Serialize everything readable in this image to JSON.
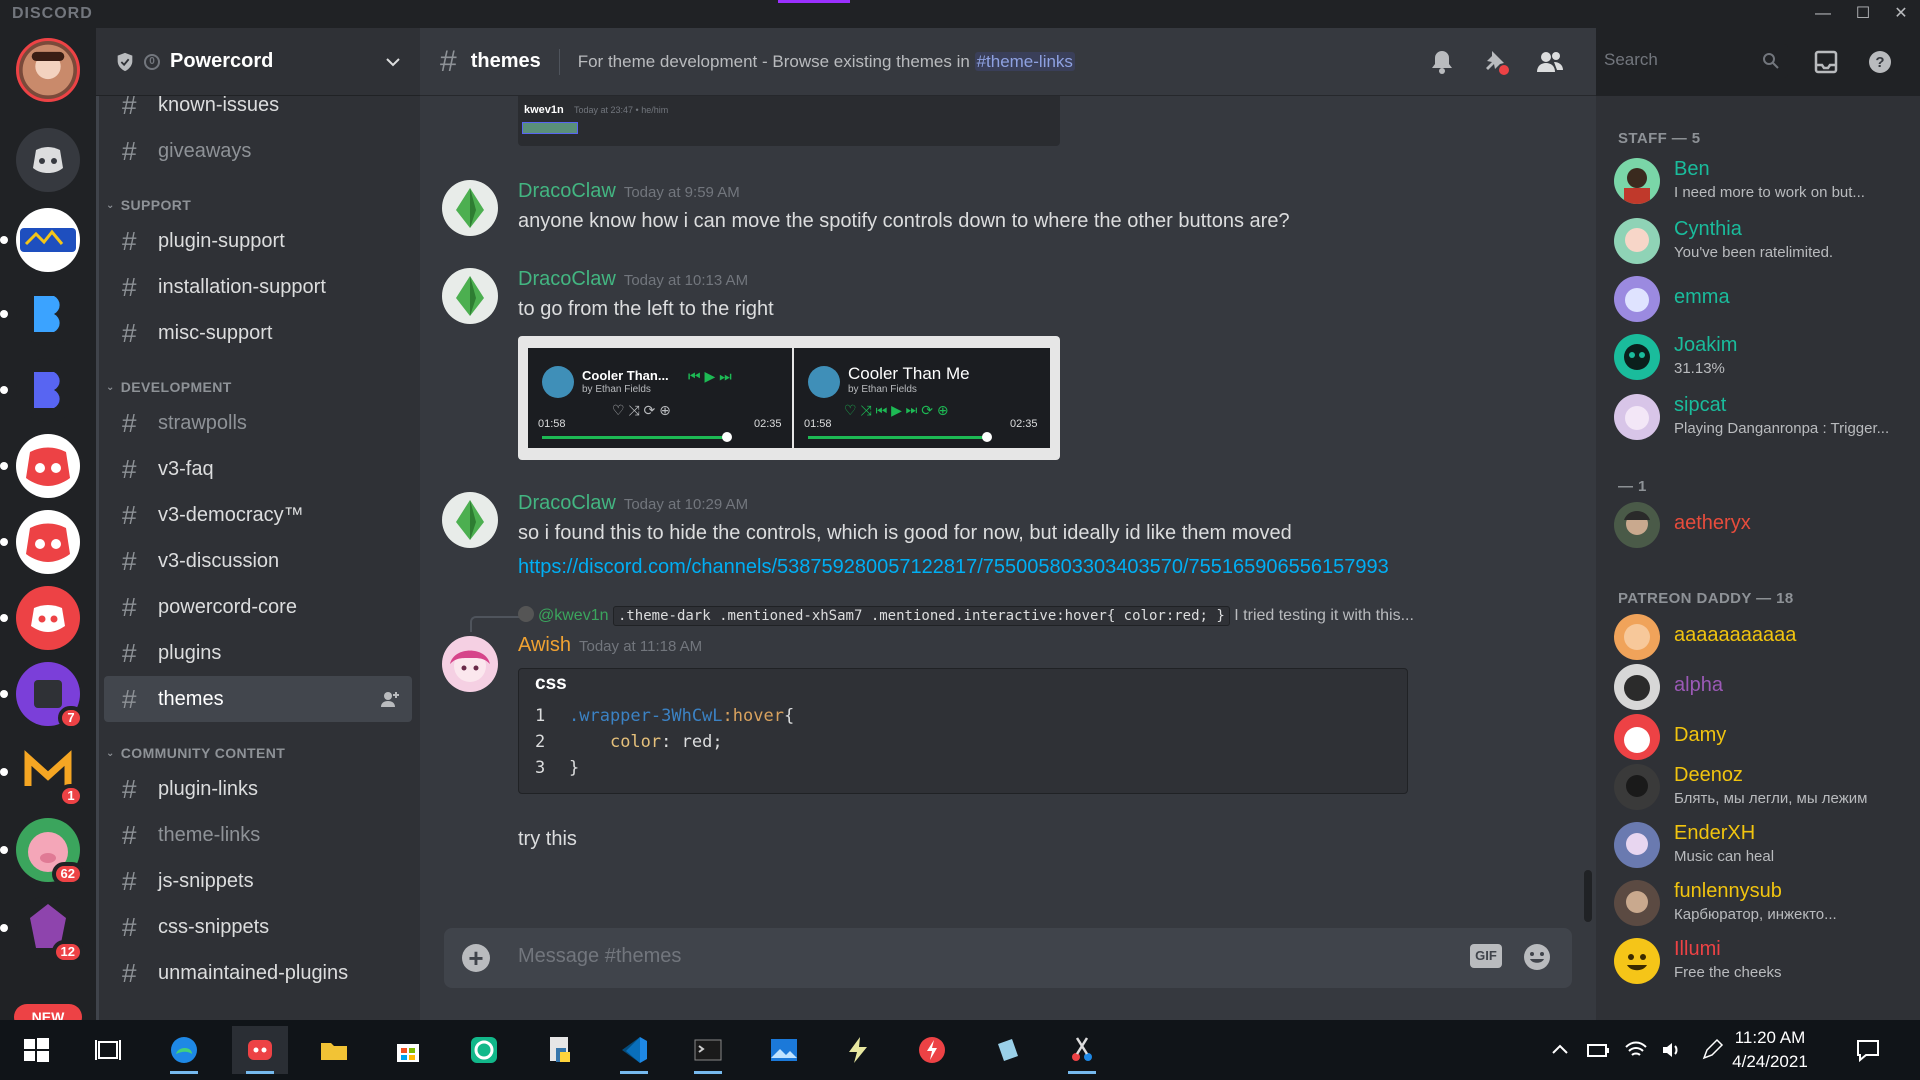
{
  "app": {
    "brand": "DISCORD"
  },
  "window_controls": {
    "minimize": "—",
    "maximize": "☐",
    "close": "✕"
  },
  "servers": [
    {
      "name": "powercord-server",
      "badge": null
    },
    {
      "name": "home",
      "badge": null
    },
    {
      "name": "sonic",
      "badge": null
    },
    {
      "name": "b3",
      "badge": null
    },
    {
      "name": "b-blue",
      "badge": null
    },
    {
      "name": "virus-1",
      "badge": null
    },
    {
      "name": "virus-2",
      "badge": null
    },
    {
      "name": "discord-red",
      "badge": null
    },
    {
      "name": "purple",
      "badge": "7"
    },
    {
      "name": "m-logo",
      "badge": "1"
    },
    {
      "name": "pig",
      "badge": "62"
    },
    {
      "name": "gem",
      "badge": "12"
    }
  ],
  "new_label": "NEW",
  "guild": {
    "name": "Powercord",
    "boost_count": "0"
  },
  "channel_sections": [
    {
      "category": null,
      "channels": [
        {
          "name": "known-issues",
          "muted": false
        },
        {
          "name": "giveaways",
          "muted": true
        }
      ]
    },
    {
      "category": "SUPPORT",
      "channels": [
        {
          "name": "plugin-support",
          "muted": false
        },
        {
          "name": "installation-support",
          "muted": false
        },
        {
          "name": "misc-support",
          "muted": false
        }
      ]
    },
    {
      "category": "DEVELOPMENT",
      "channels": [
        {
          "name": "strawpolls",
          "muted": true
        },
        {
          "name": "v3-faq",
          "muted": false
        },
        {
          "name": "v3-democracy™",
          "muted": false
        },
        {
          "name": "v3-discussion",
          "muted": false
        },
        {
          "name": "powercord-core",
          "muted": false
        },
        {
          "name": "plugins",
          "muted": false
        },
        {
          "name": "themes",
          "muted": false,
          "active": true
        }
      ]
    },
    {
      "category": "COMMUNITY CONTENT",
      "channels": [
        {
          "name": "plugin-links",
          "muted": false
        },
        {
          "name": "theme-links",
          "muted": true
        },
        {
          "name": "js-snippets",
          "muted": false
        },
        {
          "name": "css-snippets",
          "muted": false
        },
        {
          "name": "unmaintained-plugins",
          "muted": false
        }
      ]
    }
  ],
  "header": {
    "channel": "themes",
    "topic": "For theme development - Browse existing themes in ",
    "topic_link": "#theme-links",
    "search_placeholder": "Search"
  },
  "preview_strip": {
    "author": "kwev1n",
    "meta": "Today at 23:47 • he/him"
  },
  "messages": [
    {
      "author": "DracoClaw",
      "color": "#43b581",
      "time": "Today at 9:59 AM",
      "text": "anyone know how i can move the spotify controls down to where the other buttons are?"
    },
    {
      "author": "DracoClaw",
      "color": "#43b581",
      "time": "Today at 10:13 AM",
      "text": "to go from the left to the right"
    },
    {
      "author": "DracoClaw",
      "color": "#43b581",
      "time": "Today at 10:29 AM",
      "text": "so i found this to hide the controls, which is good for now, but ideally id like them moved",
      "link": "https://discord.com/channels/538759280057122817/755005803303403570/755165906556157993"
    },
    {
      "author": "Awish",
      "color": "#f0a232",
      "time": "Today at 11:18 AM",
      "reply_to": "@kwev1n",
      "reply_code": ".theme-dark .mentioned-xhSam7 .mentioned.interactive:hover{     color:red; }",
      "reply_text": " I tried testing it with this...",
      "code_lang": "css",
      "code_lines": [
        {
          "n": "1",
          "sel": ".wrapper-3WhCwL",
          "pseudo": ":hover",
          "tail": "{"
        },
        {
          "n": "2",
          "prop": "color",
          "val": ": red;"
        },
        {
          "n": "3",
          "tail": "}"
        }
      ],
      "followup": "try this"
    }
  ],
  "spotify": {
    "left": {
      "title": "Cooler Than...",
      "artist": "by Ethan Fields",
      "elapsed": "01:58",
      "total": "02:35"
    },
    "right": {
      "title": "Cooler Than Me",
      "artist": "by Ethan Fields",
      "elapsed": "01:58",
      "total": "02:35"
    }
  },
  "composer": {
    "placeholder": "Message #themes",
    "gif": "GIF"
  },
  "member_groups": [
    {
      "title": "STAFF — 5",
      "members": [
        {
          "name": "Ben",
          "color": "#1abc9c",
          "status": "I need more to work on but..."
        },
        {
          "name": "Cynthia",
          "color": "#1abc9c",
          "status": "You've been ratelimited."
        },
        {
          "name": "emma",
          "color": "#1abc9c",
          "status": ""
        },
        {
          "name": "Joakim",
          "color": "#1abc9c",
          "status": "31.13%"
        },
        {
          "name": "sipcat",
          "color": "#1abc9c",
          "status": "Playing Danganronpa : Trigger..."
        }
      ]
    },
    {
      "title": "— 1",
      "members": [
        {
          "name": "aetheryx",
          "color": "#e74c3c",
          "status": ""
        }
      ]
    },
    {
      "title": "PATREON DADDY — 18",
      "members": [
        {
          "name": "aaaaaaaaaaa",
          "color": "#f1c40f",
          "status": ""
        },
        {
          "name": "alpha",
          "color": "#9b59b6",
          "status": ""
        },
        {
          "name": "Damy",
          "color": "#f1c40f",
          "status": ""
        },
        {
          "name": "Deenoz",
          "color": "#f1c40f",
          "status": "Блять, мы легли, мы лежим"
        },
        {
          "name": "EnderXH",
          "color": "#f1c40f",
          "status": "Music can heal"
        },
        {
          "name": "funlennysub",
          "color": "#f1c40f",
          "status": "Карбюратор, инжекто..."
        },
        {
          "name": "Illumi",
          "color": "#ed4245",
          "status": "Free the cheeks"
        }
      ]
    }
  ],
  "taskbar": {
    "time": "11:20 AM",
    "date": "4/24/2021"
  },
  "colors": {
    "accent": "#5865f2",
    "online": "#3ba55d",
    "danger": "#ed4245"
  }
}
